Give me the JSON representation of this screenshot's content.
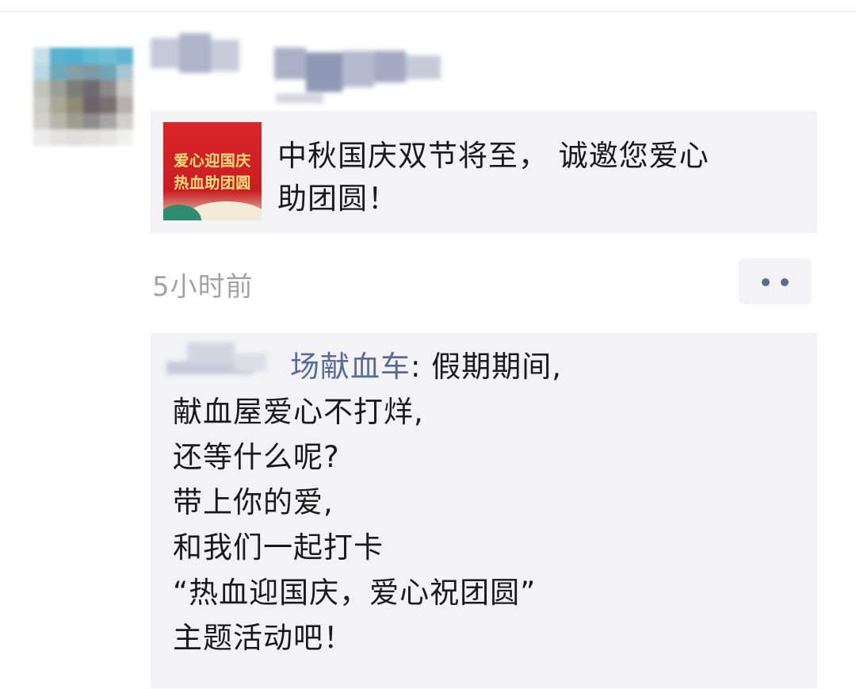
{
  "post": {
    "avatar": {
      "icon": "blurred-avatar"
    },
    "username": {
      "icon": "blurred-username"
    },
    "link_card": {
      "thumbnail_lines": [
        "爱心迎国庆",
        "热血助团圆"
      ],
      "title": "中秋国庆双节将至， 诚邀您爱心\n助团圆！"
    },
    "time": "5小时前",
    "more_button": {
      "icon": "more-dots-icon"
    }
  },
  "comment": {
    "commenter_visible": "场献血车",
    "separator": ": ",
    "text": "假期期间,\n献血屋爱心不打烊,\n还等什么呢?\n带上你的爱,\n和我们一起打卡\n“热血迎国庆，爱心祝团圆”\n主题活动吧！"
  },
  "colors": {
    "link_blue": "#576b95",
    "card_bg": "#f3f3f5",
    "time_gray": "#a3a3a3"
  }
}
